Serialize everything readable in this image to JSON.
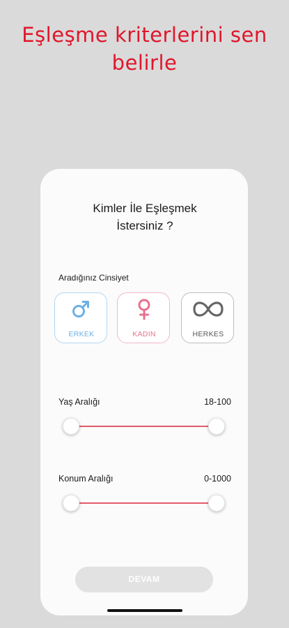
{
  "headline": {
    "line1": "Eşleşme kriterlerini sen",
    "line2": "belirle"
  },
  "screen": {
    "title_line1": "Kimler İle Eşleşmek",
    "title_line2": "İstersiniz ?",
    "gender_label": "Aradığınız Cinsiyet",
    "gender_options": [
      {
        "label": "ERKEK",
        "icon": "male-icon",
        "color": "#6ab0e6"
      },
      {
        "label": "KADIN",
        "icon": "female-icon",
        "color": "#e8708e"
      },
      {
        "label": "HERKES",
        "icon": "infinity-icon",
        "color": "#555555"
      }
    ],
    "age": {
      "label": "Yaş Aralığı",
      "value": "18-100"
    },
    "location": {
      "label": "Konum Aralığı",
      "value": "0-1000"
    },
    "continue_label": "DEVAM"
  },
  "colors": {
    "brand_red": "#e0162b",
    "slider_track": "#e25c6b",
    "disabled_button": "#e2e2e2"
  }
}
